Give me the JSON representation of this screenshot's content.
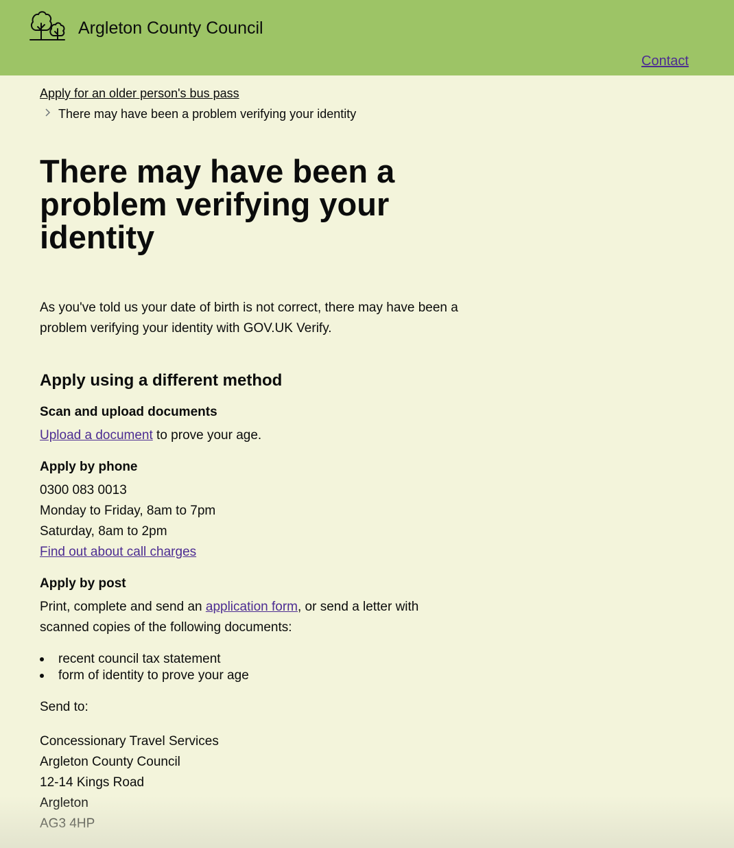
{
  "header": {
    "logo_icon": "trees-logo-icon",
    "site_title": "Argleton County Council",
    "contact_label": "Contact"
  },
  "breadcrumb": {
    "parent": "Apply for an older person's bus pass",
    "current": "There may have been a problem verifying your identity"
  },
  "main": {
    "title": "There may have been a problem verifying your identity",
    "lead": "As you've told us your date of birth is not correct, there may have been a problem verifying your identity with GOV.UK Verify.",
    "section_heading": "Apply using a different method",
    "upload": {
      "heading": "Scan and upload documents",
      "link": "Upload a document",
      "suffix": " to prove your age."
    },
    "phone": {
      "heading": "Apply by phone",
      "number": "0300 083 0013",
      "weekday_hours": "Monday to Friday, 8am to 7pm",
      "saturday_hours": "Saturday, 8am to 2pm",
      "charges_link": "Find out about call charges"
    },
    "post": {
      "heading": "Apply by post",
      "text_before": "Print, complete and send an ",
      "form_link": "application form",
      "text_after": ", or send a letter with scanned copies of the following documents:",
      "documents": [
        "recent council tax statement",
        "form of identity to prove your age"
      ],
      "send_to_label": "Send to:",
      "address": [
        "Concessionary Travel Services",
        "Argleton County Council",
        "12-14 Kings Road",
        "Argleton",
        "AG3 4HP"
      ]
    }
  },
  "colors": {
    "header_bg": "#9dc466",
    "page_bg": "#f3f4db",
    "link": "#4c2c92",
    "text": "#0b0c0c"
  }
}
